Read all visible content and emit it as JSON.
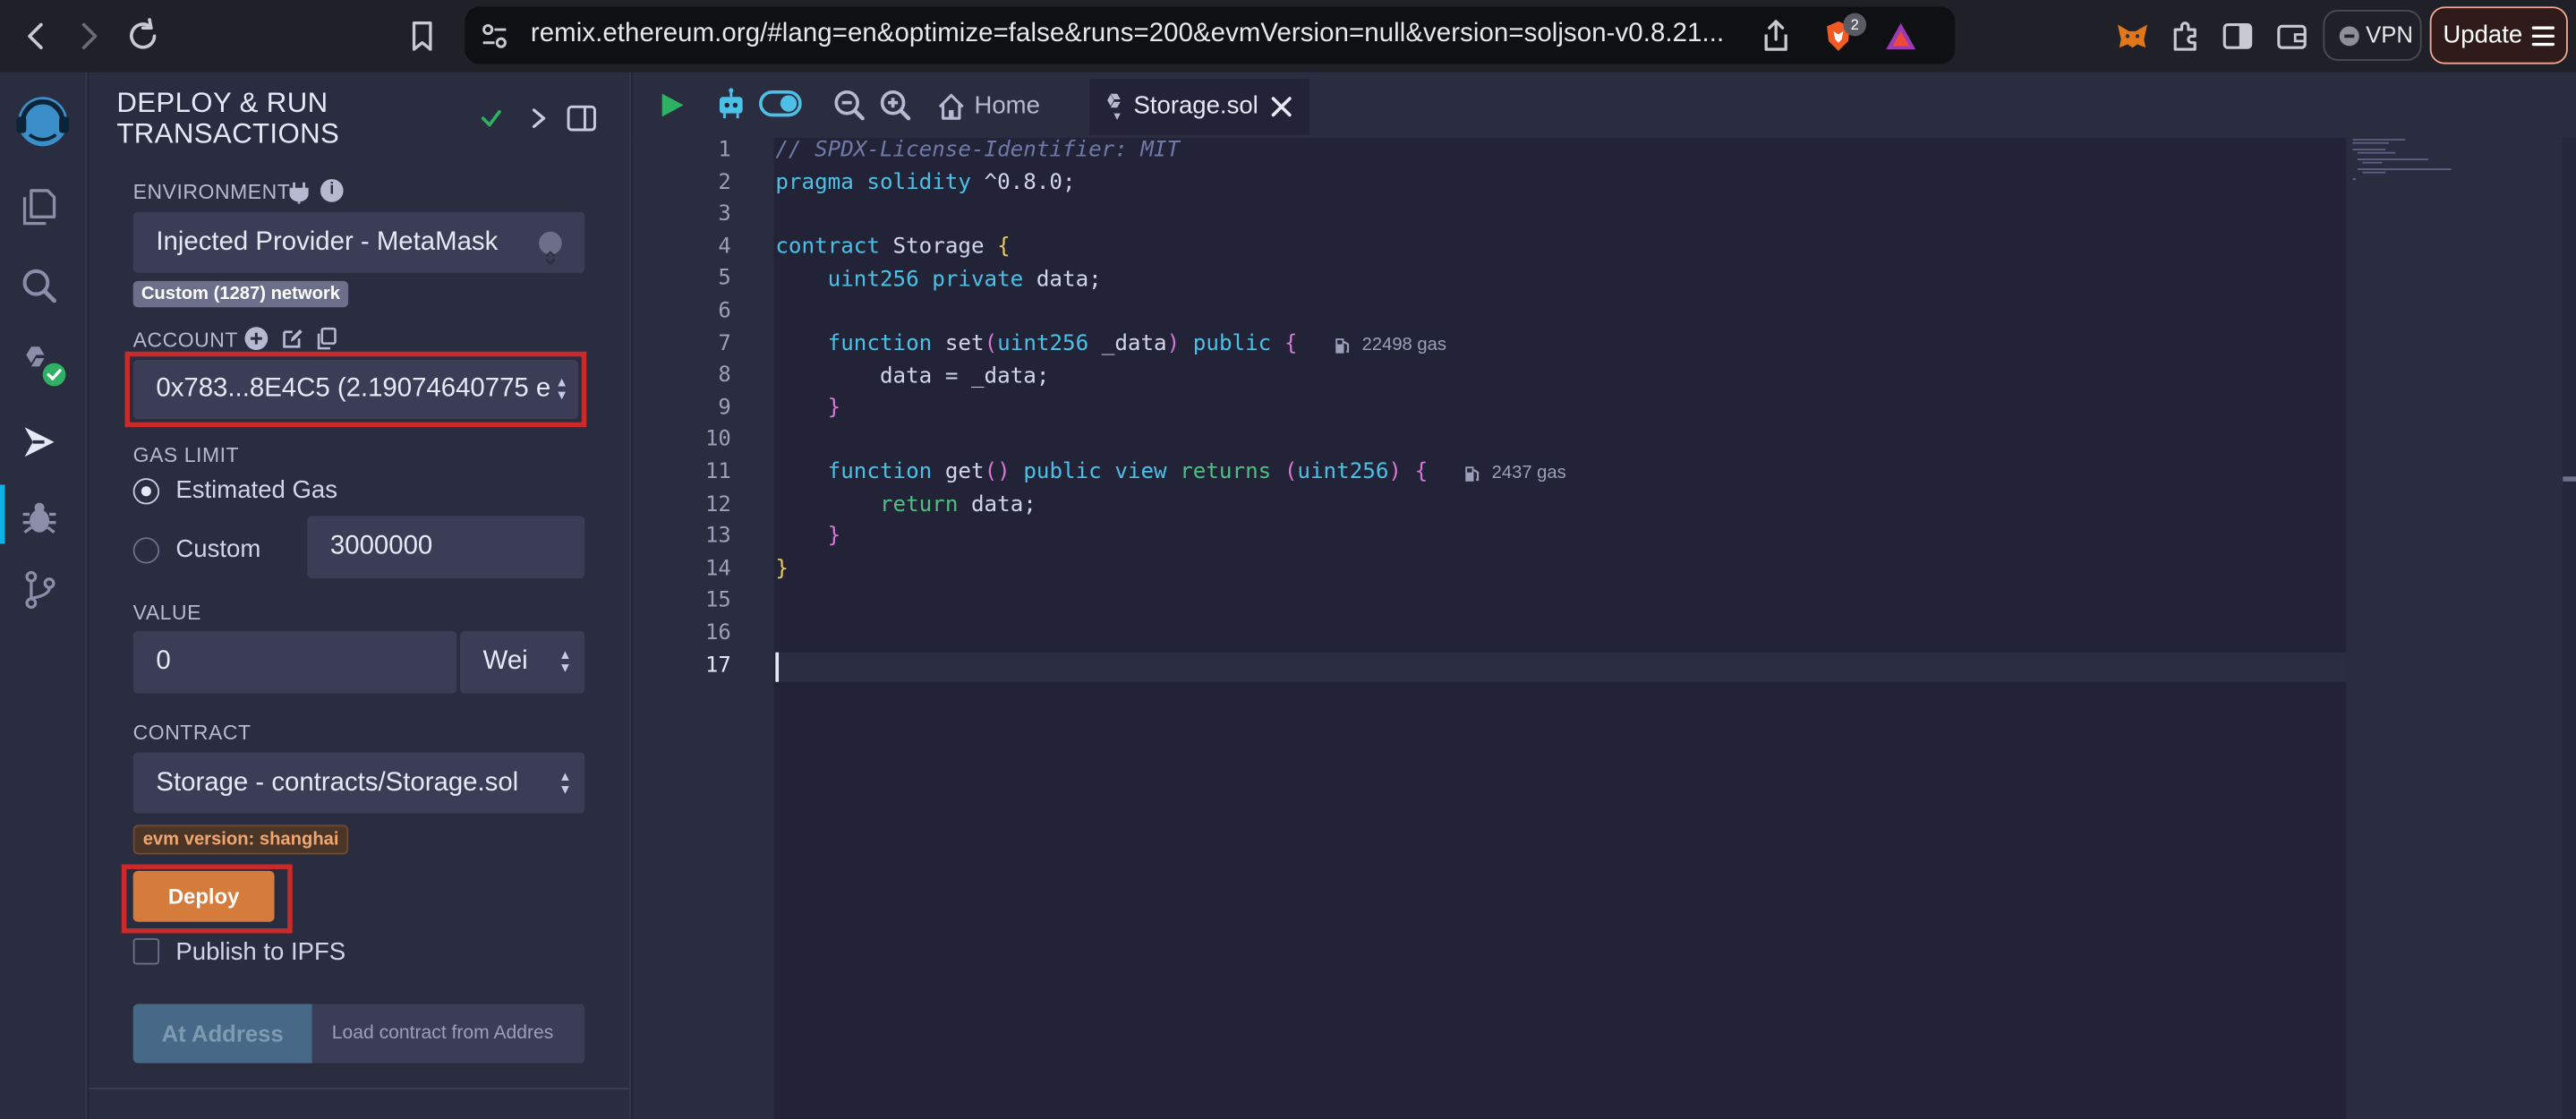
{
  "browser": {
    "url": "remix.ethereum.org/#lang=en&optimize=false&runs=200&evmVersion=null&version=soljson-v0.8.21...",
    "shield_count": "2",
    "vpn_label": "VPN",
    "update_label": "Update"
  },
  "panel": {
    "title": "DEPLOY & RUN TRANSACTIONS",
    "environment": {
      "label": "ENVIRONMENT",
      "value": "Injected Provider - MetaMask",
      "network_badge": "Custom (1287) network"
    },
    "account": {
      "label": "ACCOUNT",
      "value": "0x783...8E4C5 (2.19074640775 e"
    },
    "gas_limit": {
      "label": "GAS LIMIT",
      "estimated_label": "Estimated Gas",
      "custom_label": "Custom",
      "custom_value": "3000000",
      "selected": "estimated"
    },
    "value": {
      "label": "VALUE",
      "amount": "0",
      "unit": "Wei"
    },
    "contract": {
      "label": "CONTRACT",
      "value": "Storage - contracts/Storage.sol",
      "evm_badge": "evm version: shanghai"
    },
    "deploy_label": "Deploy",
    "publish_label": "Publish to IPFS",
    "at_address_label": "At Address",
    "load_placeholder": "Load contract from Addres"
  },
  "editor": {
    "tabs": [
      {
        "label": "Home"
      },
      {
        "label": "Storage.sol"
      }
    ],
    "active_tab": "Storage.sol",
    "line_numbers": [
      "1",
      "2",
      "3",
      "4",
      "5",
      "6",
      "7",
      "8",
      "9",
      "10",
      "11",
      "12",
      "13",
      "14",
      "15",
      "16",
      "17"
    ],
    "current_line": "17",
    "gas_hints": [
      "22498 gas",
      "2437 gas"
    ],
    "code": {
      "l1": "// SPDX-License-Identifier: MIT",
      "l2_kw": "pragma solidity",
      "l2_rest": " ^0.8.0;",
      "l4_kw": "contract",
      "l4_name": " Storage ",
      "l5_type": "uint256",
      "l5_mod": " private",
      "l5_rest": " data;",
      "l7_kw": "function",
      "l7_name": " set",
      "l7_type": "uint256",
      "l7_param": " _data",
      "l7_vis": " public ",
      "l8": "data = _data;",
      "l11_kw": "function",
      "l11_name": " get",
      "l11_vis": " public view ",
      "l11_ret": "returns",
      "l11_type": "uint256",
      "l12_kw": "return",
      "l12_rest": " data;"
    }
  },
  "colors": {
    "accent": "#0fb3e3",
    "deploy": "#d57b3c",
    "highlight": "#c92a2a",
    "background": "#222336",
    "panel": "#2a2c3f"
  }
}
